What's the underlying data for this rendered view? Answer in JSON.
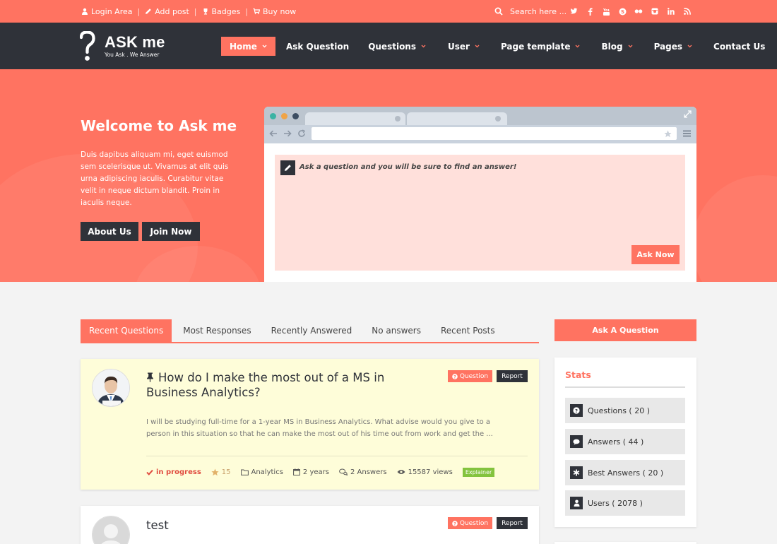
{
  "topbar": {
    "links": [
      {
        "label": "Login Area",
        "icon": "user-icon"
      },
      {
        "label": "Add post",
        "icon": "pencil-icon"
      },
      {
        "label": "Badges",
        "icon": "trophy-icon"
      },
      {
        "label": "Buy now",
        "icon": "cart-icon"
      }
    ],
    "search_placeholder": "Search here ...",
    "socials": [
      "twitter-icon",
      "facebook-icon",
      "youtube-icon",
      "skype-icon",
      "flickr-icon",
      "instagram-icon",
      "linkedin-icon",
      "rss-icon"
    ]
  },
  "logo": {
    "name": "ASK me",
    "tagline": "You Ask . We Answer"
  },
  "nav": [
    {
      "label": "Home",
      "dropdown": true,
      "active": true
    },
    {
      "label": "Ask Question",
      "dropdown": false
    },
    {
      "label": "Questions",
      "dropdown": true
    },
    {
      "label": "User",
      "dropdown": true
    },
    {
      "label": "Page template",
      "dropdown": true
    },
    {
      "label": "Blog",
      "dropdown": true
    },
    {
      "label": "Pages",
      "dropdown": true
    },
    {
      "label": "Contact Us",
      "dropdown": false
    }
  ],
  "hero": {
    "title": "Welcome to Ask me",
    "lead": "Duis dapibus aliquam mi, eget euismod sem scelerisque ut. Vivamus at elit quis urna adipiscing iaculis. Curabitur vitae velit in neque dictum blandit. Proin in iaculis neque.",
    "about_label": "About Us",
    "join_label": "Join Now",
    "ask_placeholder": "Ask a question and you will be sure to find an answer!",
    "ask_button": "Ask Now"
  },
  "tabs": [
    "Recent Questions",
    "Most Responses",
    "Recently Answered",
    "No answers",
    "Recent Posts"
  ],
  "questions": [
    {
      "title": "How do I make the most out of a MS in Business Analytics?",
      "excerpt": "I will be studying full-time for a 1-year MS in Business Analytics. What advise would you give to a person in this situation so that he can make the most out of his time out from work and get the ...",
      "badge": "Question",
      "report": "Report",
      "status": "in progress",
      "rating": "15",
      "category": "Analytics",
      "time": "2 years",
      "answers": "2 Answers",
      "views": "15587 views",
      "tag": "Explainer"
    },
    {
      "title": "test",
      "badge": "Question",
      "report": "Report"
    }
  ],
  "sidebar": {
    "ask_button": "Ask A Question",
    "stats_title": "Stats",
    "stats": [
      {
        "label": "Questions ( 20 )",
        "icon": "question-icon"
      },
      {
        "label": "Answers ( 44 )",
        "icon": "comment-icon"
      },
      {
        "label": "Best Answers ( 20 )",
        "icon": "asterisk-icon"
      },
      {
        "label": "Users ( 2078 )",
        "icon": "user-icon"
      }
    ]
  },
  "colors": {
    "accent": "#ff7361",
    "dark": "#2f3239",
    "featured_bg": "#fefdd9",
    "tag_green": "#83c33e"
  }
}
